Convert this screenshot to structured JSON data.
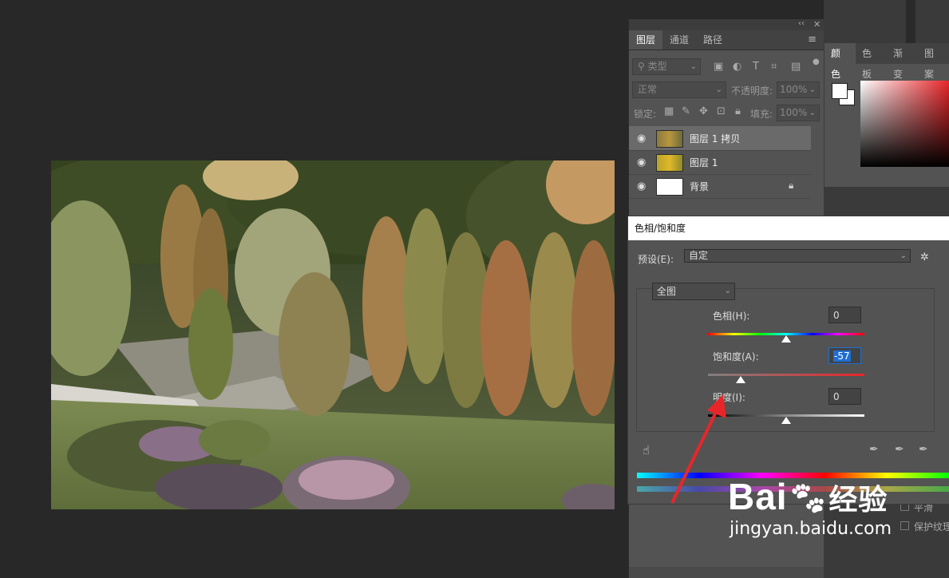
{
  "layers_panel": {
    "tabs": [
      "图层",
      "通道",
      "路径"
    ],
    "filter_label": "类型",
    "blend_mode": "正常",
    "opacity_label": "不透明度:",
    "opacity_value": "100%",
    "lock_label": "锁定:",
    "fill_label": "填充:",
    "fill_value": "100%",
    "layers": [
      {
        "name": "图层 1 拷贝",
        "selected": true
      },
      {
        "name": "图层 1",
        "selected": false
      },
      {
        "name": "背景",
        "selected": false,
        "locked": true
      }
    ]
  },
  "color_panel": {
    "tabs": [
      "颜色",
      "色板",
      "渐变",
      "图案"
    ]
  },
  "dialog": {
    "title": "色相/饱和度",
    "preset_label": "预设(E):",
    "preset_value": "自定",
    "channel_value": "全图",
    "hue_label": "色相(H):",
    "hue_value": "0",
    "saturation_label": "饱和度(A):",
    "saturation_value": "-57",
    "lightness_label": "明度(I):",
    "lightness_value": "0"
  },
  "bottom_options": [
    "平滑",
    "保护纹理"
  ],
  "watermark": {
    "brand": "Bai",
    "suffix": "经验",
    "url": "jingyan.baidu.com"
  },
  "colors": {
    "accent_blue": "#1f6fd1",
    "annotation_arrow": "#e8262a"
  }
}
